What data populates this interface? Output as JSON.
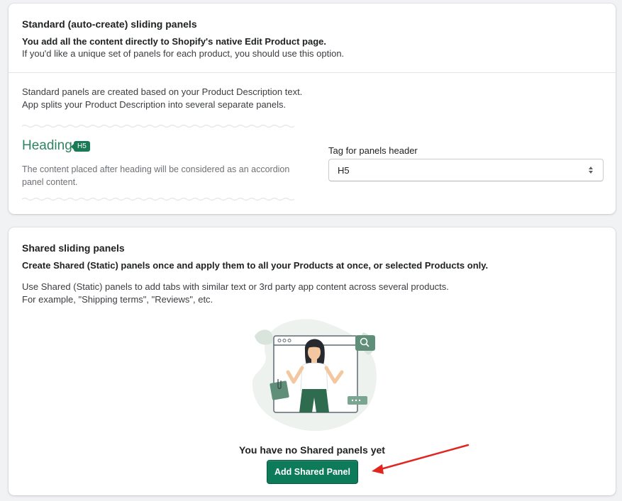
{
  "standard": {
    "title": "Standard (auto-create) sliding panels",
    "bold_line": "You add all the content directly to Shopify's native Edit Product page.",
    "sub_line": "If you'd like a unique set of panels for each product, you should use this option.",
    "desc_line1": "Standard panels are created based on your Product Description text.",
    "desc_line2": "App splits your Product Description into several separate panels.",
    "demo_heading": "Heading",
    "demo_badge": "H5",
    "demo_desc": "The content placed after heading will be considered as an accordion panel content.",
    "select_label": "Tag for panels header",
    "select_value": "H5"
  },
  "shared": {
    "title": "Shared sliding panels",
    "bold_line": "Create Shared (Static) panels once and apply them to all your Products at once, or selected Products only.",
    "desc_line1": "Use Shared (Static) panels to add tabs with similar text or 3rd party app content across several products.",
    "desc_line2": "For example, \"Shipping terms\", \"Reviews\", etc.",
    "empty_title": "You have no Shared panels yet",
    "add_button": "Add Shared Panel"
  },
  "colors": {
    "accent": "#0d7a5a",
    "heading_green": "#2f8463",
    "arrow_red": "#e0261f"
  }
}
